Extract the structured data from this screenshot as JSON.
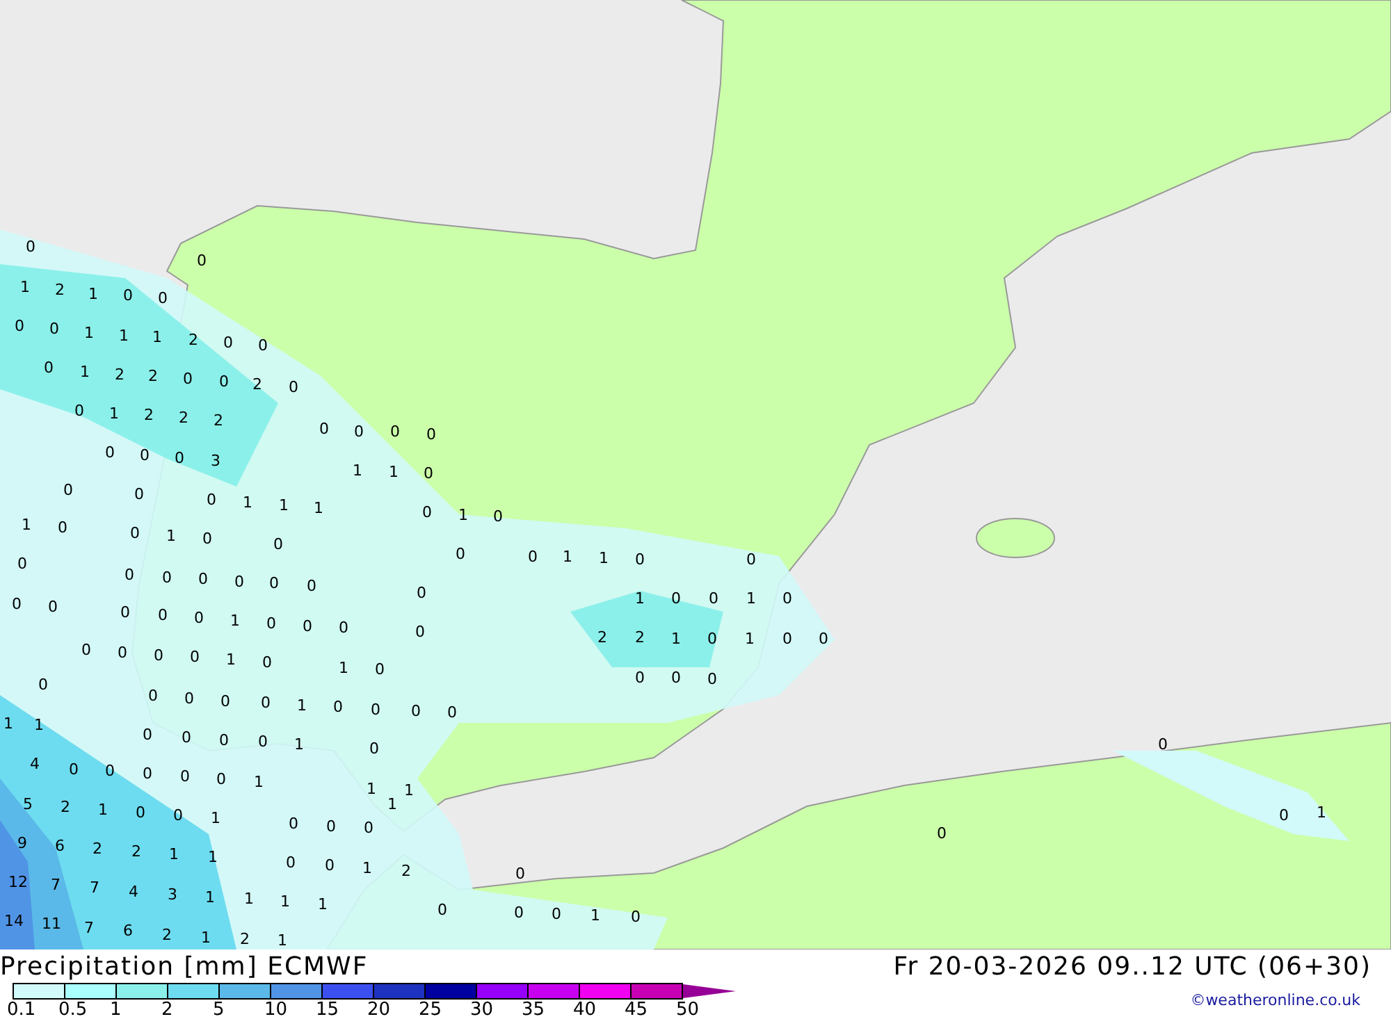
{
  "map_labels": [
    "0",
    "0",
    "1",
    "2",
    "1",
    "0",
    "0",
    "0",
    "0",
    "1",
    "1",
    "1",
    "2",
    "0",
    "0",
    "0",
    "1",
    "2",
    "2",
    "0",
    "0",
    "2",
    "0",
    "0",
    "1",
    "2",
    "2",
    "2",
    "0",
    "0",
    "0",
    "0",
    "0",
    "0",
    "0",
    "3",
    "1",
    "1",
    "0",
    "0",
    "0",
    "0",
    "1",
    "1",
    "1",
    "0",
    "1",
    "0",
    "1",
    "0",
    "0",
    "1",
    "0",
    "0",
    "0",
    "0",
    "0",
    "1",
    "1",
    "0",
    "0",
    "0",
    "0",
    "0",
    "0",
    "0",
    "0",
    "0",
    "0",
    "0",
    "0",
    "0",
    "0",
    "1",
    "0",
    "0",
    "0",
    "1",
    "0",
    "0",
    "1",
    "0",
    "0",
    "2",
    "2",
    "1",
    "0",
    "1",
    "0",
    "0",
    "0",
    "0",
    "0",
    "0",
    "1",
    "0",
    "1",
    "0",
    "0",
    "0",
    "0",
    "0",
    "0",
    "0",
    "0",
    "0",
    "1",
    "0",
    "0",
    "0",
    "0",
    "1",
    "1",
    "0",
    "0",
    "0",
    "0",
    "1",
    "0",
    "0",
    "4",
    "0",
    "0",
    "0",
    "0",
    "0",
    "1",
    "5",
    "2",
    "1",
    "0",
    "0",
    "1",
    "1",
    "1",
    "1",
    "0",
    "0",
    "0",
    "0",
    "0",
    "1",
    "9",
    "6",
    "2",
    "2",
    "1",
    "1",
    "0",
    "0",
    "1",
    "2",
    "0",
    "12",
    "7",
    "7",
    "4",
    "3",
    "1",
    "1",
    "1",
    "1",
    "14",
    "11",
    "7",
    "6",
    "2",
    "1",
    "2",
    "1",
    "0",
    "0",
    "0",
    "1",
    "0"
  ],
  "title": "Precipitation [mm] ECMWF",
  "valid_time": "Fr 20-03-2026 09..12 UTC (06+30)",
  "credit": "©weatheronline.co.uk",
  "legend": [
    {
      "label": "0.1",
      "color": "#d2fafa"
    },
    {
      "label": "0.5",
      "color": "#aaffff"
    },
    {
      "label": "1",
      "color": "#8cf0ea"
    },
    {
      "label": "2",
      "color": "#6edcf0"
    },
    {
      "label": "5",
      "color": "#5ab9e8"
    },
    {
      "label": "10",
      "color": "#5094e6"
    },
    {
      "label": "15",
      "color": "#3c50f0"
    },
    {
      "label": "20",
      "color": "#1e32c0"
    },
    {
      "label": "25",
      "color": "#0000a0"
    },
    {
      "label": "30",
      "color": "#9600fa"
    },
    {
      "label": "35",
      "color": "#c800f0"
    },
    {
      "label": "40",
      "color": "#f000f0"
    },
    {
      "label": "45",
      "color": "#c800b4"
    },
    {
      "label": "50",
      "color": "#960096"
    }
  ]
}
